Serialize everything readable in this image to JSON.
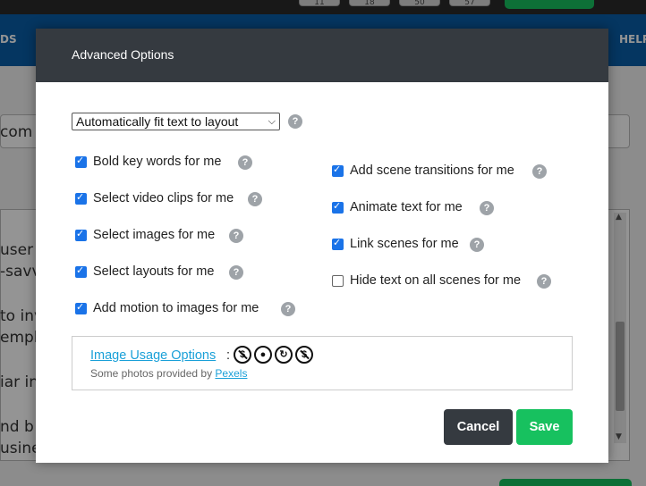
{
  "background": {
    "timers": [
      "11",
      "18",
      "50",
      "57"
    ],
    "nav_left": "DS",
    "nav_right": "HELP",
    "field_text": "com",
    "text_lines": [
      "user",
      "-savv",
      "to inv",
      "empl",
      "iar in",
      "nd b",
      "usine"
    ]
  },
  "modal": {
    "title": "Advanced Options",
    "fit_select": {
      "value": "Automatically fit text to layout",
      "options": [
        "Automatically fit text to layout"
      ]
    },
    "help_glyph": "?",
    "left_options": [
      {
        "label": "Bold key words for me",
        "checked": true
      },
      {
        "label": "Select video clips for me",
        "checked": true
      },
      {
        "label": "Select images for me",
        "checked": true
      },
      {
        "label": "Select layouts for me",
        "checked": true
      },
      {
        "label": "Add motion to images for me",
        "checked": true
      }
    ],
    "right_options": [
      {
        "label": "Add scene transitions for me",
        "checked": true
      },
      {
        "label": "Animate text for me",
        "checked": true
      },
      {
        "label": "Link scenes for me",
        "checked": true
      },
      {
        "label": "Hide text on all scenes for me",
        "checked": false
      }
    ],
    "usage": {
      "link_text": "Image Usage Options",
      "colon": ":",
      "license_icons": [
        "no-commercial-icon",
        "attribution-icon",
        "share-alike-icon",
        "no-dollar-icon"
      ],
      "photos_prefix": "Some photos provided by ",
      "photos_link": "Pexels"
    },
    "buttons": {
      "cancel": "Cancel",
      "save": "Save"
    },
    "colors": {
      "header": "#353a40",
      "accent_green": "#17c15f",
      "checkbox_blue": "#1a73e8",
      "link_blue": "#1aa0d8"
    }
  }
}
